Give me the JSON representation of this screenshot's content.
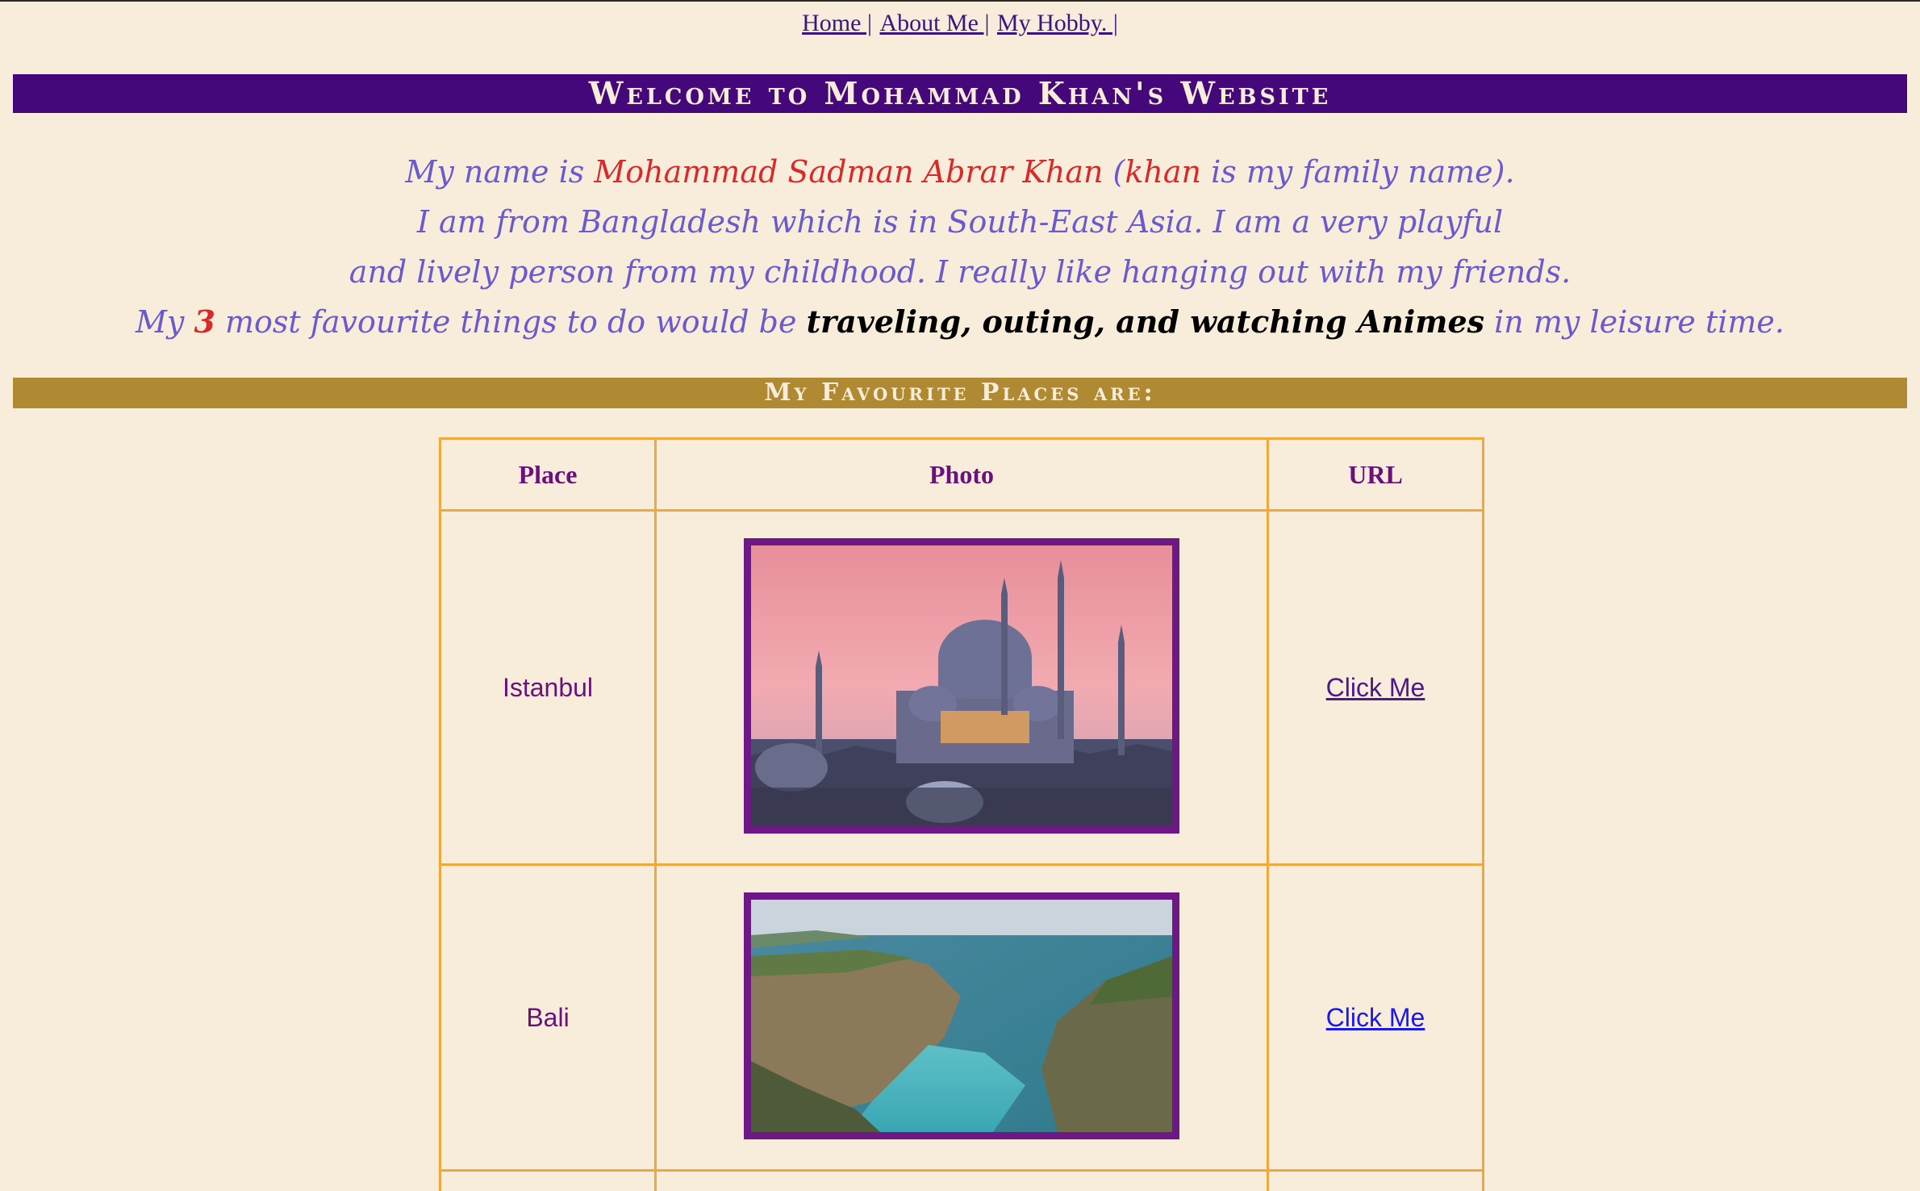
{
  "nav": {
    "items": [
      {
        "label": "Home |"
      },
      {
        "label": "About Me |"
      },
      {
        "label": "My Hobby. |"
      }
    ]
  },
  "header": {
    "title": "Welcome to Mohammad Khan's Website"
  },
  "intro": {
    "line1_prefix": "My name is ",
    "full_name": "Mohammad Sadman Abrar Khan",
    "line1_paren_open": " (",
    "family_name": "khan",
    "line1_suffix": " is my family name).",
    "line2": "I am from Bangladesh which is in South-East Asia. I am a very playful",
    "line3": "and lively person from my childhood. I really like hanging out with my friends.",
    "line4_prefix": "My ",
    "count": "3",
    "line4_mid": " most favourite things to do would be ",
    "hobbies": "traveling, outing, and watching Animes",
    "line4_suffix": " in my leisure time."
  },
  "places_section": {
    "title": "My Favourite Places are:",
    "columns": [
      "Place",
      "Photo",
      "URL"
    ],
    "rows": [
      {
        "place": "Istanbul",
        "photo": "istanbul-mosque-photo",
        "url_label": "Click Me",
        "link_color": "#4a1a8a"
      },
      {
        "place": "Bali",
        "photo": "bali-coast-photo",
        "url_label": "Click Me",
        "link_color": "#1a1ae6"
      }
    ]
  },
  "colors": {
    "background": "#f8ecda",
    "welcome_banner": "#44087a",
    "places_banner": "#b08a33",
    "table_border": "#f0a83c",
    "photo_frame": "#6e1885",
    "intro_text": "#6a5acd",
    "highlight_red": "#d82a2a"
  }
}
